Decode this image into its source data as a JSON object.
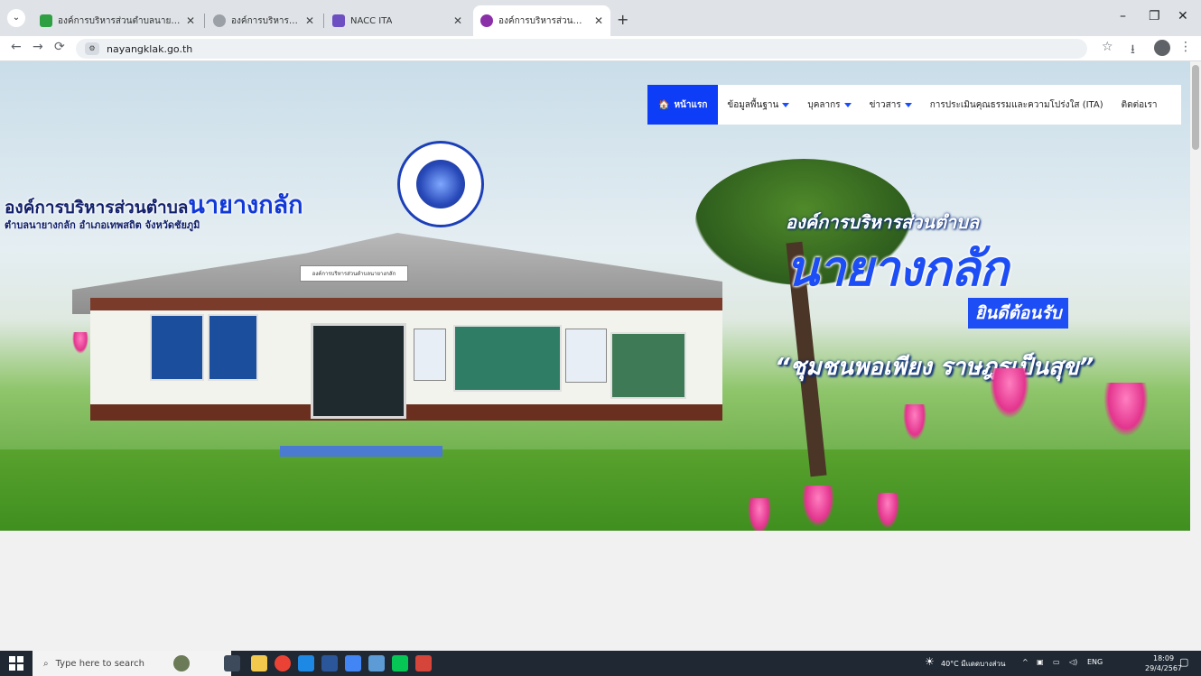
{
  "browser": {
    "tabs": [
      {
        "title": "องค์การบริหารส่วนตำบลนายางกลัก",
        "active": false
      },
      {
        "title": "องค์การบริหารส่วนตำบลหนองบัว อำเภอ",
        "active": false
      },
      {
        "title": "NACC ITA",
        "active": false
      },
      {
        "title": "องค์การบริหารส่วนตำบลนายางกลัก",
        "active": true
      }
    ],
    "url": "nayangklak.go.th"
  },
  "navbar": {
    "home": "หน้าแรก",
    "items": [
      "ข้อมูลพื้นฐาน",
      "บุคลากร",
      "ข่าวสาร",
      "การประเมินคุณธรรมและความโปร่งใส (ITA)",
      "ติดต่อเรา"
    ]
  },
  "banner": {
    "org_prefix": "องค์การบริหารส่วนตำบล",
    "org_name": "นายางกลัก",
    "org_address": "ตำบลนายางกลัก อำเภอเทพสถิต จังหวัดชัยภูมิ",
    "sign_text": "องค์การบริหารส่วนตำบลนายางกลัก",
    "welcome_line1": "องค์การบริหารส่วนตำบล",
    "welcome_line2": "นายางกลัก",
    "welcome_line3": "ยินดีต้อนรับ",
    "slogan": "“ชุมชนพอเพียง ราษฎรเป็นสุข”"
  },
  "taskbar": {
    "search_placeholder": "Type here to search",
    "weather": "40°C มีแดดบางส่วน",
    "language": "ENG",
    "time": "18:09",
    "date": "29/4/2567"
  },
  "colors": {
    "nav_active": "#0d3df6",
    "brand_blue": "#1d4df4"
  }
}
